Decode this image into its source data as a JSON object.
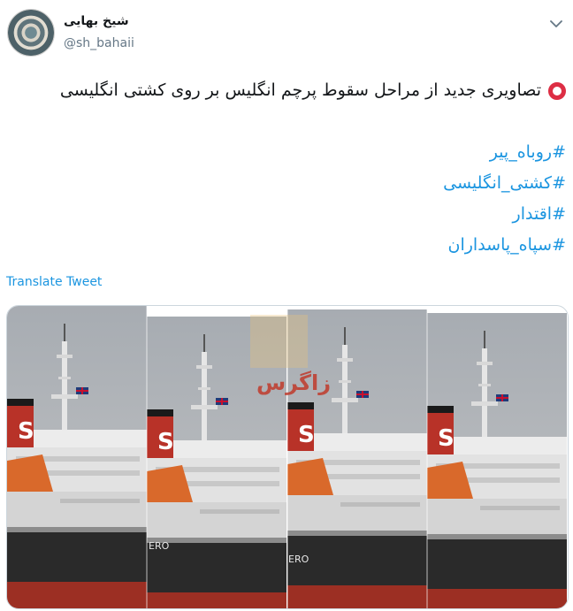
{
  "author": {
    "display_name": "شیخ بهایی",
    "handle": "@sh_bahaii",
    "avatar_icon": "avatar-mosaic-icon"
  },
  "menu": {
    "icon": "chevron-down-icon"
  },
  "tweet": {
    "marker_icon": "red-circle-icon",
    "marker_color": "#dd2e44",
    "text": "تصاویری جدید از مراحل سقوط پرچم انگلیس بر روی کشتی انگلیسی",
    "hashtags": [
      "#روباه_پیر",
      "#کشتی_انگلیسی",
      "#اقتدار",
      "#سپاه_پاسداران"
    ],
    "hashtag_color": "#1b95e0"
  },
  "translate_label": "Translate Tweet",
  "media": {
    "watermark": "زاگرس",
    "watermark_color": "#c0392b",
    "funnel_text": "S",
    "hull_text": "ERO"
  }
}
